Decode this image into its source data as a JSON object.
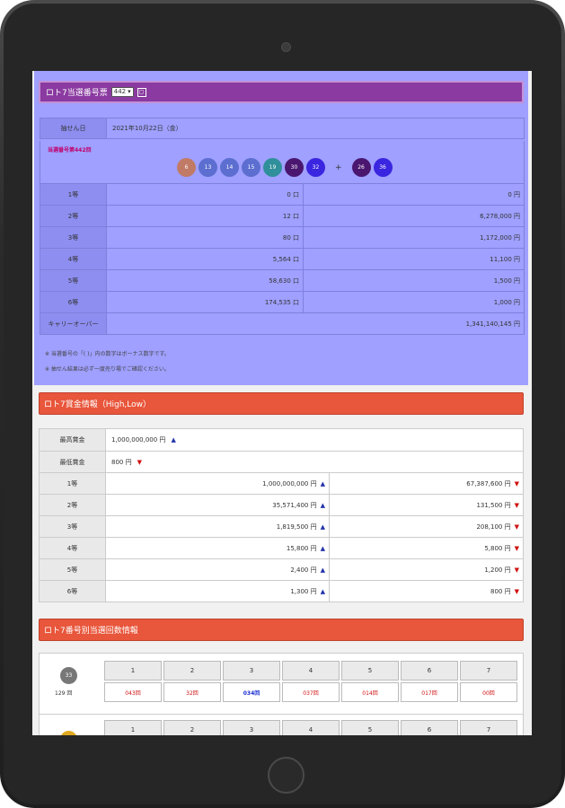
{
  "results": {
    "title": "ロト7当選番号票",
    "round_select": "442",
    "date_label": "抽せん日",
    "date_value": "2021年10月22日（金）",
    "round_label": "当選番号第442回",
    "main_numbers": [
      "6",
      "13",
      "14",
      "15",
      "19",
      "30",
      "32"
    ],
    "bonus_numbers": [
      "26",
      "36"
    ],
    "plus": "+",
    "rows": [
      {
        "label": "1等",
        "count": "0 口",
        "prize": "0 円"
      },
      {
        "label": "2等",
        "count": "12 口",
        "prize": "6,278,000 円"
      },
      {
        "label": "3等",
        "count": "80 口",
        "prize": "1,172,000 円"
      },
      {
        "label": "4等",
        "count": "5,564 口",
        "prize": "11,100 円"
      },
      {
        "label": "5等",
        "count": "58,630 口",
        "prize": "1,500 円"
      },
      {
        "label": "6等",
        "count": "174,535 口",
        "prize": "1,000 円"
      }
    ],
    "carryover_label": "キャリーオーバー",
    "carryover_value": "1,341,140,145 円",
    "notes": [
      "※ 当選番号の「( )」内の数字はボーナス数字です。",
      "※ 抽せん結果は必ず一度売り場でご確認ください。"
    ]
  },
  "prize_info": {
    "title": "ロト7賞金情報（High,Low）",
    "max_label": "最高賞金",
    "max_value": "1,000,000,000 円",
    "min_label": "最低賞金",
    "min_value": "800 円",
    "rows": [
      {
        "label": "1等",
        "high": "1,000,000,000 円",
        "low": "67,387,600 円"
      },
      {
        "label": "2等",
        "high": "35,571,400 円",
        "low": "131,500 円"
      },
      {
        "label": "3等",
        "high": "1,819,500 円",
        "low": "208,100 円"
      },
      {
        "label": "4等",
        "high": "15,800 円",
        "low": "5,800 円"
      },
      {
        "label": "5等",
        "high": "2,400 円",
        "low": "1,200 円"
      },
      {
        "label": "6等",
        "high": "1,300 円",
        "low": "800 円"
      }
    ]
  },
  "count_info": {
    "title": "ロト7番号別当選回数情報",
    "number": "33",
    "number_count": "129 回",
    "headers": [
      "1",
      "2",
      "3",
      "4",
      "5",
      "6",
      "7"
    ],
    "values": [
      "043回",
      "32回",
      "034回",
      "037回",
      "014回",
      "017回",
      "00回"
    ],
    "headers2": [
      "1",
      "2",
      "3",
      "4",
      "5",
      "6",
      "7"
    ]
  },
  "colors": {
    "ball_1": "#c07a66",
    "ball_2": "#5c6ed0",
    "ball_3": "#5c6ed0",
    "ball_4": "#5c6ed0",
    "ball_5": "#2f8f9a",
    "ball_6": "#4a1670",
    "ball_7": "#3a25e0",
    "bonus_1": "#4a1670",
    "bonus_2": "#3a25e0"
  }
}
